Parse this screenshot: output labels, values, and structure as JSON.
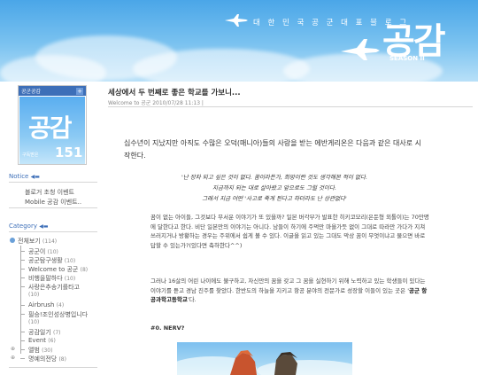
{
  "header": {
    "tagline": "대 한 민 국 공 군 대 표 블 로 그",
    "logo": "공감",
    "season": "SEASON II"
  },
  "sidebar": {
    "profile": {
      "header_label": "공군공감",
      "plus": "+",
      "logo": "공감",
      "subscribers_label": "구독받은",
      "count": "151"
    },
    "notice": {
      "title": "Notice",
      "items": [
        "블로거 초청 이벤트",
        "Mobile 공감 이벤트.."
      ]
    },
    "category": {
      "title": "Category",
      "root": {
        "label": "전체보기",
        "count": "(114)"
      },
      "items": [
        {
          "label": "공군이",
          "count": "(10)"
        },
        {
          "label": "공군탐구생활",
          "count": "(10)"
        },
        {
          "label": "Welcome to 공군",
          "count": "(8)"
        },
        {
          "label": "비행을말하다",
          "count": "(10)"
        },
        {
          "label": "사랑은추송기를타고",
          "count": "(10)"
        },
        {
          "label": "Airbrush",
          "count": "(4)"
        },
        {
          "label": "필승!조인성상병입니다",
          "count": "(10)"
        },
        {
          "label": "공감일기",
          "count": "(7)"
        },
        {
          "label": "Event",
          "count": "(6)"
        },
        {
          "label": "앨범",
          "count": "(30)"
        },
        {
          "label": "명예의전당",
          "count": "(8)"
        }
      ]
    }
  },
  "post": {
    "title": "세상에서 두 번째로 좋은 학교를 가보니...",
    "meta": "Welcome to 공군  2010/07/28 11:13 |",
    "intro": "십수년이 지났지만 아직도 수많은 오덕(매니아)들의 사랑을 받는 에반게리온은 다음과 같은 대사로 시작한다.",
    "quote_lines": [
      "'난 장차 되고 싶은 것이 없다. 꿈이라든가, 희망이란 것도 생각해본 적이 없다.",
      "지금까지 되는 대로 살아왔고 앞으로도 그럴 것이다.",
      "그래서 지금 어떤 '사고로 죽게 된다고 하더라도 난 상관없다'"
    ],
    "paragraph1": "꿈이 없는 아이들, 그것보다 무서운 이야기가 또 있을까? 일본 버각부가 발표한 히키코모리(은둔형 외톨이)는 70만명에 달한다고 한다. 비단 일본만의 이야기는 아니다. 남들이 하기에 주먹만 마을가듯 없이 그대로 따라만 가다가 지쳐 쓰러지거나 방황하는 경우는 주위에서 쉽게 볼 수 있다. 이글을 읽고 있는 그대도 막상 꿈이 무엇이냐고 물으면 바로 답할 수 있는가?(있다면 축하한다^^)",
    "paragraph2_start": "그러나 16살의 어린 나이에도 불구하고, 자신만의 꿈을 갖고 그 꿈을 실현하기 위해 노력하고 있는 학생들이 있다는 이야기를 듣고 경남 진주를 찾았다. 한반도의 하늘을 지키고 항공 분야의 전문가로 성장할 이들이 있는 곳은 '",
    "paragraph2_bold": "공군 항공과학고등학교",
    "paragraph2_end": "'다.",
    "heading": "#0. NERV?"
  },
  "colors": {
    "header_sky": "#4aa6e8",
    "accent_blue": "#3d6fb8"
  }
}
